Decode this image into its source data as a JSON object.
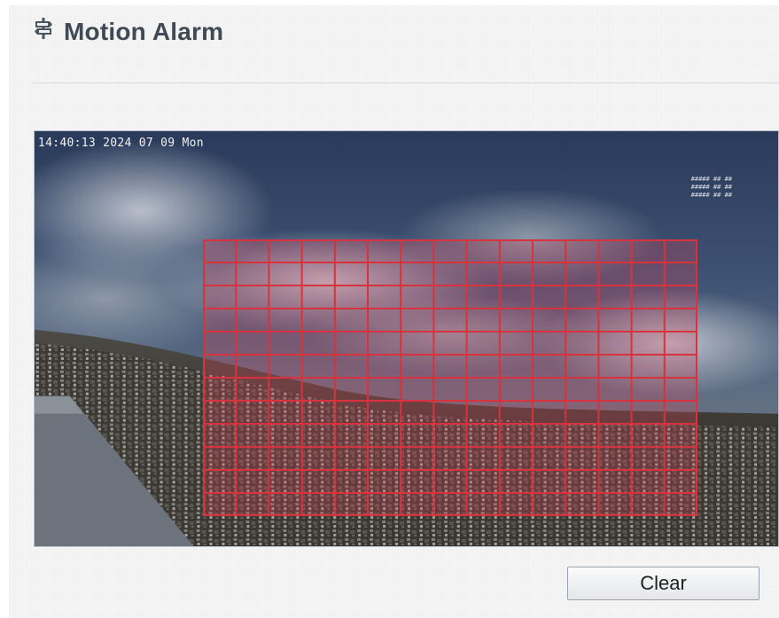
{
  "header": {
    "title": "Motion Alarm",
    "icon": "signpost-icon"
  },
  "video": {
    "osd_timestamp": "14:40:13 2024 07 09 Mon",
    "osd_side_text": "##### ## ##\n##### ## ##\n##### ## ##",
    "motion_grid": {
      "columns": 15,
      "rows": 12,
      "line_color": "#d8323c",
      "fill_color": "#e0465a"
    }
  },
  "actions": {
    "clear_label": "Clear"
  }
}
